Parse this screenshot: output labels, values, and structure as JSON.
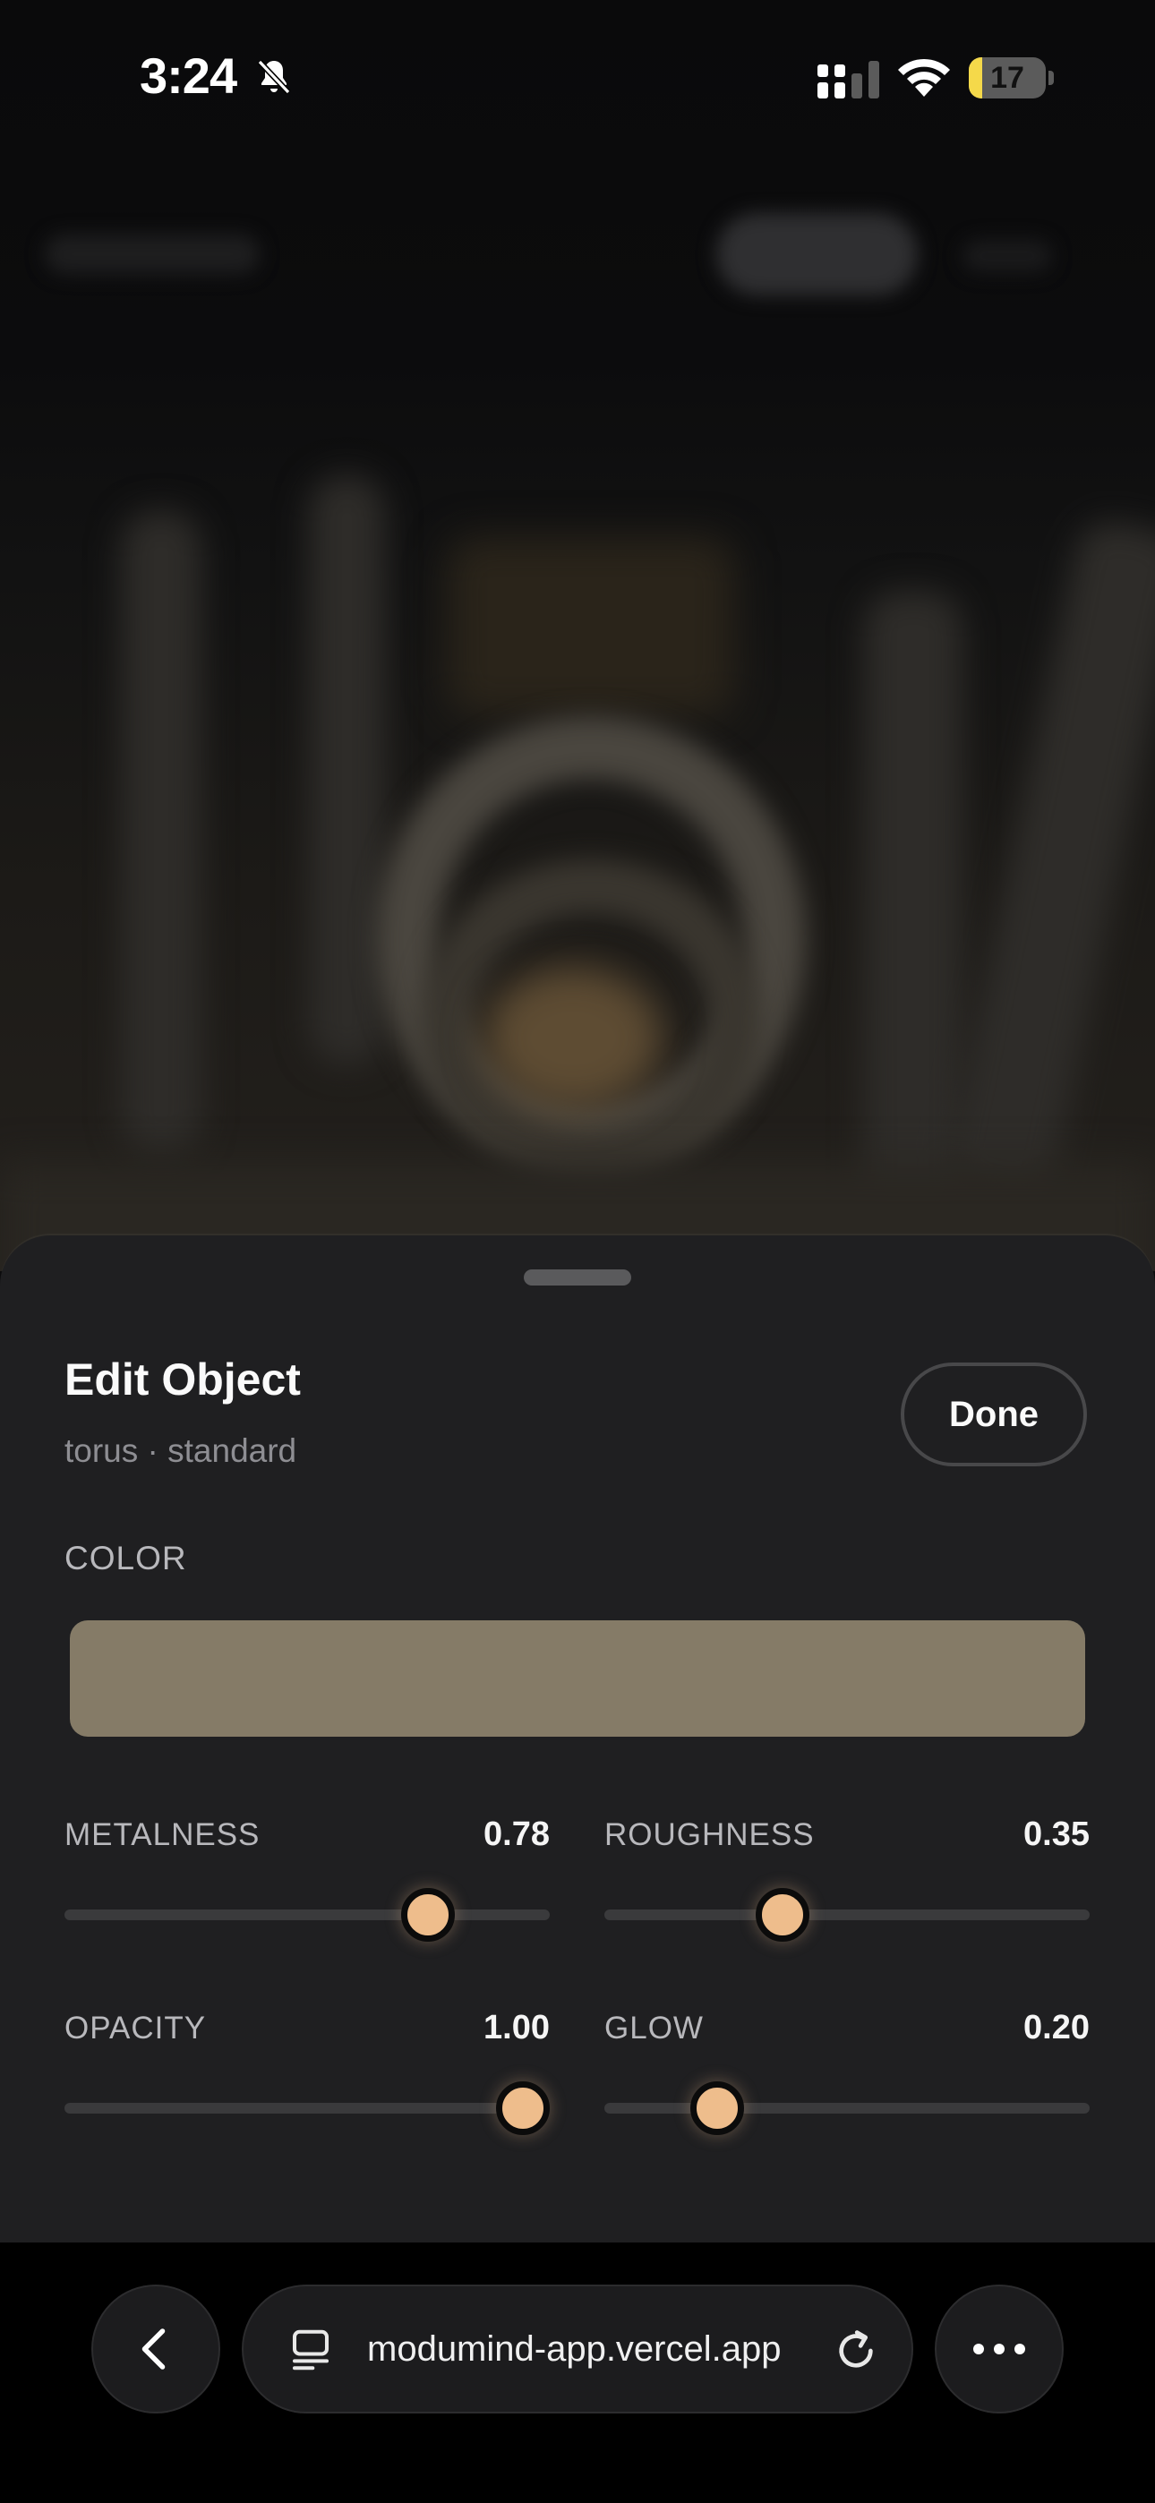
{
  "status_bar": {
    "time": "3:24",
    "battery_level": "17",
    "battery_fraction": 0.17
  },
  "sheet": {
    "title": "Edit Object",
    "subtitle": "torus · standard",
    "done_label": "Done",
    "color_label": "COLOR",
    "color_value": "#857b67",
    "accent_color": "#eebd8c",
    "controls": [
      {
        "label": "METALNESS",
        "value": "0.78",
        "fraction": 0.78
      },
      {
        "label": "ROUGHNESS",
        "value": "0.35",
        "fraction": 0.35
      },
      {
        "label": "OPACITY",
        "value": "1.00",
        "fraction": 1.0
      },
      {
        "label": "GLOW",
        "value": "0.20",
        "fraction": 0.2
      }
    ]
  },
  "browser": {
    "url": "modumind-app.vercel.app",
    "icons": [
      "back-chevron-icon",
      "tabs-icon",
      "reload-icon",
      "more-icon"
    ]
  }
}
